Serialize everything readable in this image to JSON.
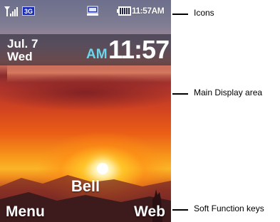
{
  "status_bar": {
    "network_badge": "3G",
    "clock": "11:57AM",
    "icons": [
      "signal-strength-icon",
      "network-3g-icon",
      "message-icon",
      "battery-icon"
    ]
  },
  "home_screen": {
    "date": "Jul. 7",
    "weekday": "Wed",
    "ampm": "AM",
    "time": "11:57",
    "carrier": "Bell",
    "wallpaper": "sunset"
  },
  "softkeys": {
    "left": "Menu",
    "right": "Web"
  },
  "callouts": {
    "icons": "Icons",
    "main_display": "Main Display area",
    "soft_keys": "Soft Function keys"
  },
  "colors": {
    "ampm_text": "#69d6ee",
    "network_badge_bg": "#1a2cb4",
    "time_band": "#28283a"
  }
}
